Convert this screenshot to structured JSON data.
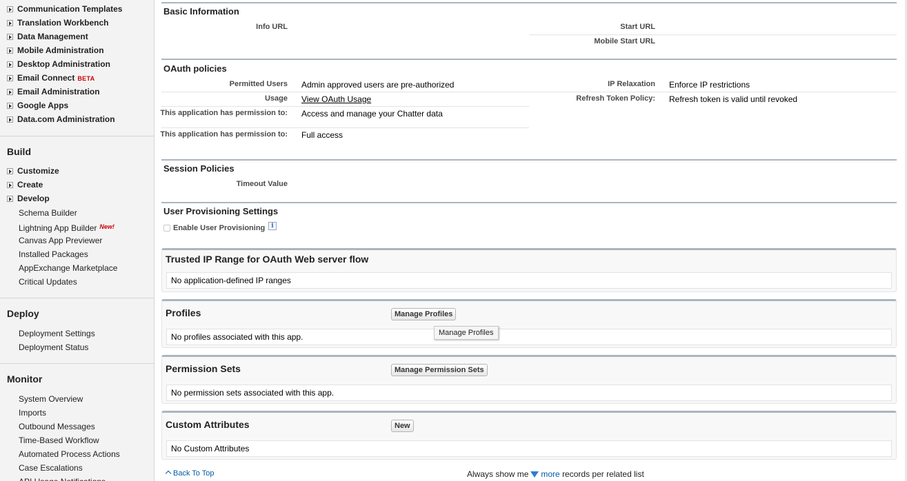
{
  "sidebar": {
    "admin_items": [
      {
        "label": "Communication Templates"
      },
      {
        "label": "Translation Workbench"
      },
      {
        "label": "Data Management"
      },
      {
        "label": "Mobile Administration"
      },
      {
        "label": "Desktop Administration"
      },
      {
        "label": "Email Connect",
        "badge": "BETA"
      },
      {
        "label": "Email Administration"
      },
      {
        "label": "Google Apps"
      },
      {
        "label": "Data.com Administration"
      }
    ],
    "build": {
      "title": "Build",
      "items": [
        {
          "label": "Customize"
        },
        {
          "label": "Create"
        },
        {
          "label": "Develop"
        }
      ],
      "sub_items": [
        {
          "label": "Schema Builder"
        },
        {
          "label": "Lightning App Builder",
          "badge": "New!"
        },
        {
          "label": "Canvas App Previewer"
        },
        {
          "label": "Installed Packages"
        },
        {
          "label": "AppExchange Marketplace"
        },
        {
          "label": "Critical Updates"
        }
      ]
    },
    "deploy": {
      "title": "Deploy",
      "items": [
        {
          "label": "Deployment Settings"
        },
        {
          "label": "Deployment Status"
        }
      ]
    },
    "monitor": {
      "title": "Monitor",
      "items": [
        {
          "label": "System Overview"
        },
        {
          "label": "Imports"
        },
        {
          "label": "Outbound Messages"
        },
        {
          "label": "Time-Based Workflow"
        },
        {
          "label": "Automated Process Actions"
        },
        {
          "label": "Case Escalations"
        },
        {
          "label": "API Usage Notifications"
        }
      ]
    }
  },
  "basic_info": {
    "title": "Basic Information",
    "info_url_label": "Info URL",
    "start_url_label": "Start URL",
    "mobile_start_url_label": "Mobile Start URL"
  },
  "oauth": {
    "title": "OAuth policies",
    "permitted_users_label": "Permitted Users",
    "permitted_users_value": "Admin approved users are pre-authorized",
    "usage_label": "Usage",
    "usage_link": "View OAuth Usage",
    "perm1_label": "This application has permission to:",
    "perm1_value": "Access and manage your Chatter data",
    "perm2_label": "This application has permission to:",
    "perm2_value": "Full access",
    "ip_relaxation_label": "IP Relaxation",
    "ip_relaxation_value": "Enforce IP restrictions",
    "refresh_label": "Refresh Token Policy:",
    "refresh_value": "Refresh token is valid until revoked"
  },
  "session": {
    "title": "Session Policies",
    "timeout_label": "Timeout Value"
  },
  "provisioning": {
    "title": "User Provisioning Settings",
    "enable_label": "Enable User Provisioning",
    "info_icon": "i"
  },
  "trusted_ip": {
    "title": "Trusted IP Range for OAuth Web server flow",
    "empty": "No application-defined IP ranges"
  },
  "profiles": {
    "title": "Profiles",
    "button": "Manage Profiles",
    "tooltip": "Manage Profiles",
    "empty": "No profiles associated with this app."
  },
  "permission_sets": {
    "title": "Permission Sets",
    "button": "Manage Permission Sets",
    "empty": "No permission sets associated with this app."
  },
  "custom_attributes": {
    "title": "Custom Attributes",
    "button": "New",
    "empty": "No Custom Attributes"
  },
  "footer": {
    "back_to_top": "Back To Top",
    "always_show": "Always show me",
    "more": "more",
    "records_per_list": "records per related list"
  }
}
